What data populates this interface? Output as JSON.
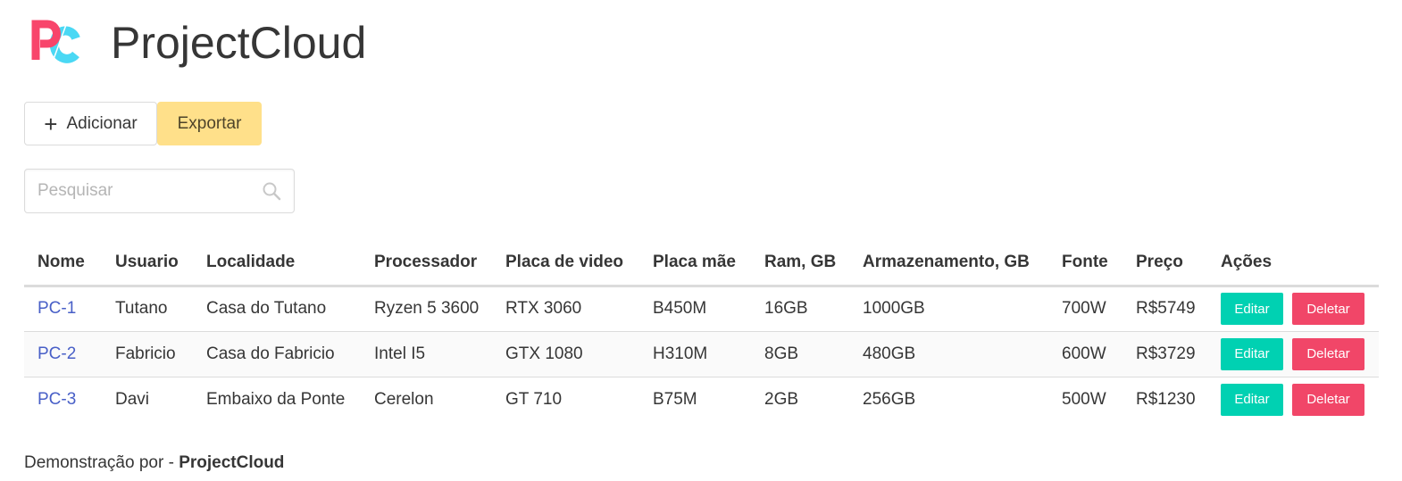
{
  "app": {
    "title": "ProjectCloud",
    "brand_colors": {
      "pink": "#f8456b",
      "cyan": "#4ad8f4"
    }
  },
  "toolbar": {
    "add_label": "Adicionar",
    "add_icon": "plus-icon",
    "export_label": "Exportar"
  },
  "search": {
    "placeholder": "Pesquisar",
    "value": "",
    "icon": "search-icon"
  },
  "table": {
    "headers": [
      "Nome",
      "Usuario",
      "Localidade",
      "Processador",
      "Placa de video",
      "Placa mãe",
      "Ram, GB",
      "Armazenamento, GB",
      "Fonte",
      "Preço",
      "Ações"
    ],
    "rows": [
      {
        "nome": "PC-1",
        "usuario": "Tutano",
        "localidade": "Casa do Tutano",
        "processador": "Ryzen 5 3600",
        "placa_video": "RTX 3060",
        "placa_mae": "B450M",
        "ram": "16GB",
        "armazenamento": "1000GB",
        "fonte": "700W",
        "preco": "R$5749"
      },
      {
        "nome": "PC-2",
        "usuario": "Fabricio",
        "localidade": "Casa do Fabricio",
        "processador": "Intel I5",
        "placa_video": "GTX 1080",
        "placa_mae": "H310M",
        "ram": "8GB",
        "armazenamento": "480GB",
        "fonte": "600W",
        "preco": "R$3729"
      },
      {
        "nome": "PC-3",
        "usuario": "Davi",
        "localidade": "Embaixo da Ponte",
        "processador": "Cerelon",
        "placa_video": "GT 710",
        "placa_mae": "B75M",
        "ram": "2GB",
        "armazenamento": "256GB",
        "fonte": "500W",
        "preco": "R$1230"
      }
    ],
    "actions": {
      "edit_label": "Editar",
      "delete_label": "Deletar"
    }
  },
  "footer": {
    "prefix": "Demonstração por - ",
    "brand": "ProjectCloud"
  },
  "colors": {
    "edit_button": "#00d1b2",
    "delete_button": "#f14668",
    "export_button": "#ffe08a",
    "link": "#485fc7"
  }
}
